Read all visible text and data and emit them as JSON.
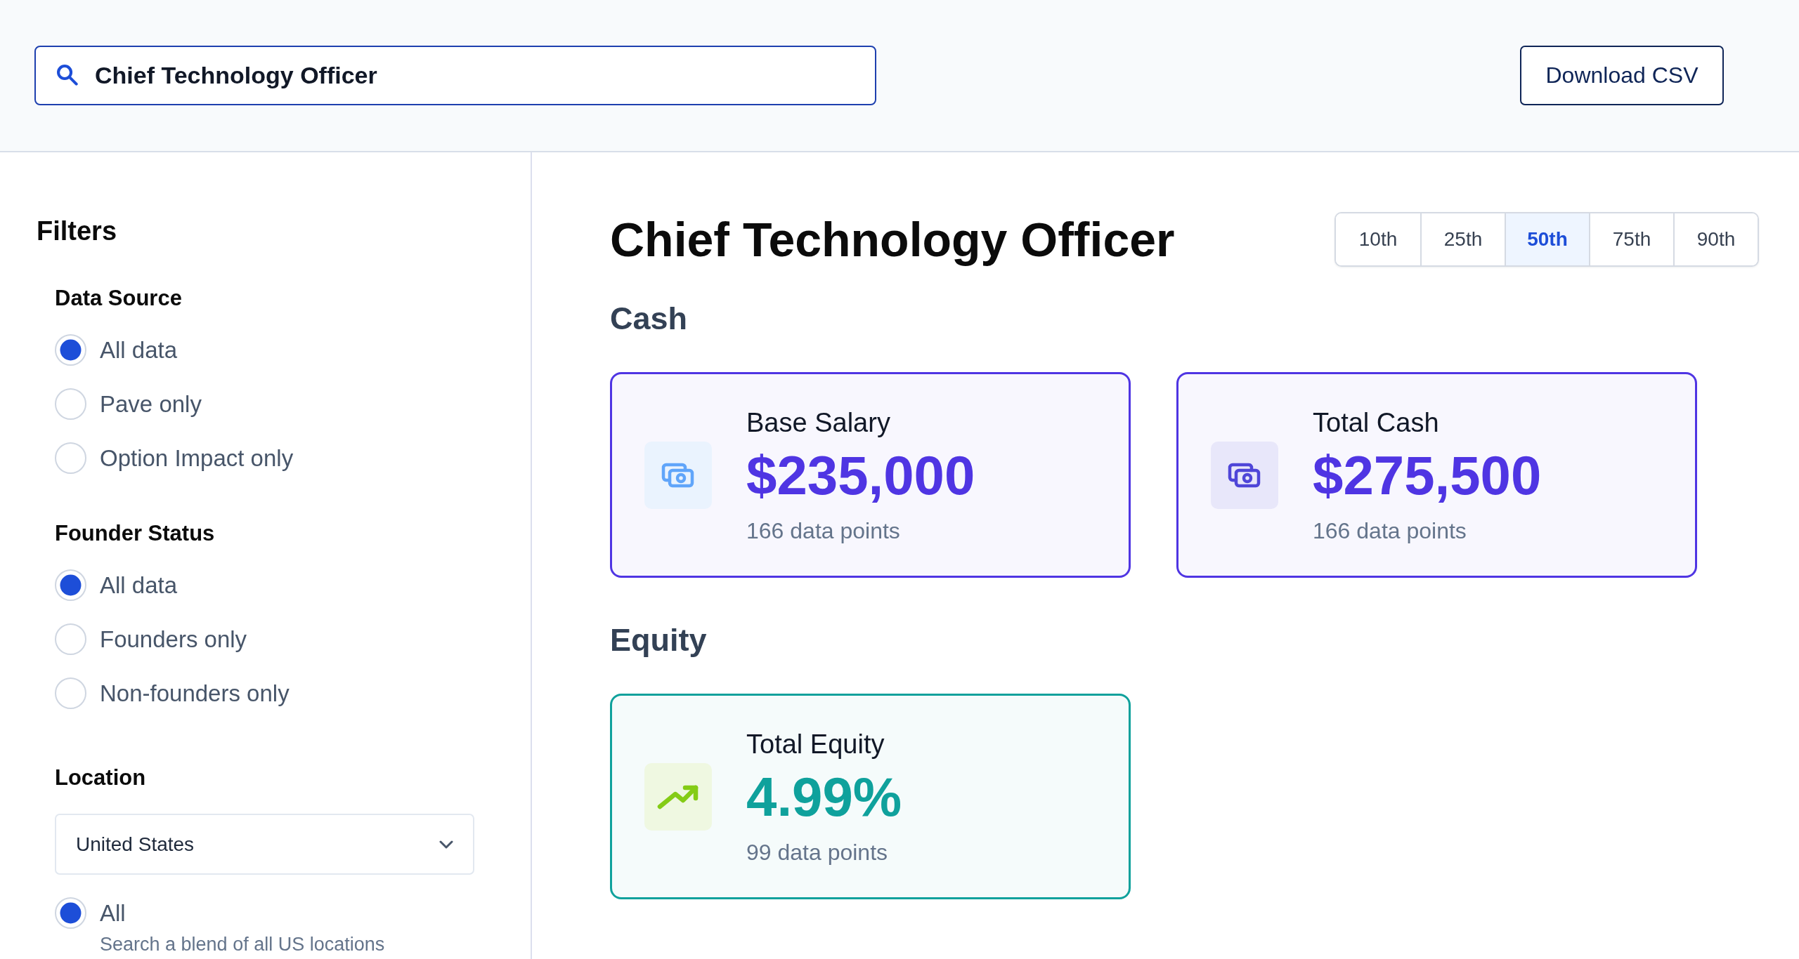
{
  "search": {
    "value": "Chief Technology Officer"
  },
  "download_button": {
    "label": "Download CSV"
  },
  "filters": {
    "title": "Filters",
    "groups": [
      {
        "title": "Data Source",
        "options": [
          {
            "label": "All data",
            "selected": true
          },
          {
            "label": "Pave only",
            "selected": false
          },
          {
            "label": "Option Impact only",
            "selected": false
          }
        ]
      },
      {
        "title": "Founder Status",
        "options": [
          {
            "label": "All data",
            "selected": true
          },
          {
            "label": "Founders only",
            "selected": false
          },
          {
            "label": "Non-founders only",
            "selected": false
          }
        ]
      },
      {
        "title": "Location",
        "select": {
          "value": "United States"
        },
        "options": [
          {
            "label": "All",
            "description": "Search a blend of all US locations",
            "selected": true
          }
        ]
      }
    ]
  },
  "page_title": "Chief Technology Officer",
  "percentiles": [
    {
      "label": "10th",
      "selected": false
    },
    {
      "label": "25th",
      "selected": false
    },
    {
      "label": "50th",
      "selected": true
    },
    {
      "label": "75th",
      "selected": false
    },
    {
      "label": "90th",
      "selected": false
    }
  ],
  "sections": [
    {
      "title": "Cash",
      "cards": [
        {
          "label": "Base Salary",
          "value": "$235,000",
          "data_points": "166 data points",
          "color": "#4f35e3",
          "icon": {
            "kind": "money",
            "color": "#60a5fa"
          }
        },
        {
          "label": "Total Cash",
          "value": "$275,500",
          "data_points": "166 data points",
          "color": "#4f35e3",
          "icon": {
            "kind": "money",
            "color": "#4f46d8"
          }
        }
      ]
    },
    {
      "title": "Equity",
      "cards": [
        {
          "label": "Total Equity",
          "value": "4.99%",
          "data_points": "99 data points",
          "color": "#0fa19c",
          "icon": {
            "kind": "trend",
            "color": "#84cc16"
          }
        }
      ]
    }
  ]
}
